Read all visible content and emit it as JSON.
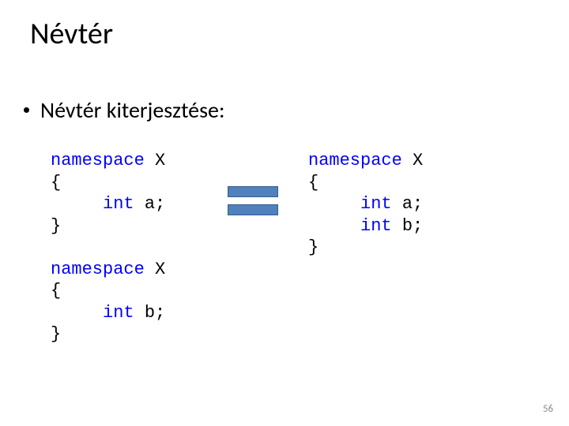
{
  "title": "Névtér",
  "bullet": "Névtér kiterjesztése:",
  "code_left": {
    "l1a": "namespace",
    "l1b": " X",
    "l2": "{",
    "l3a": "     ",
    "l3b": "int",
    "l3c": " a;",
    "l4": "}",
    "l5": "",
    "l6a": "namespace",
    "l6b": " X",
    "l7": "{",
    "l8a": "     ",
    "l8b": "int",
    "l8c": " b;",
    "l9": "}"
  },
  "code_right": {
    "l1a": "namespace",
    "l1b": " X",
    "l2": "{",
    "l3a": "     ",
    "l3b": "int",
    "l3c": " a;",
    "l4a": "     ",
    "l4b": "int",
    "l4c": " b;",
    "l5": "}"
  },
  "page_number": "56"
}
